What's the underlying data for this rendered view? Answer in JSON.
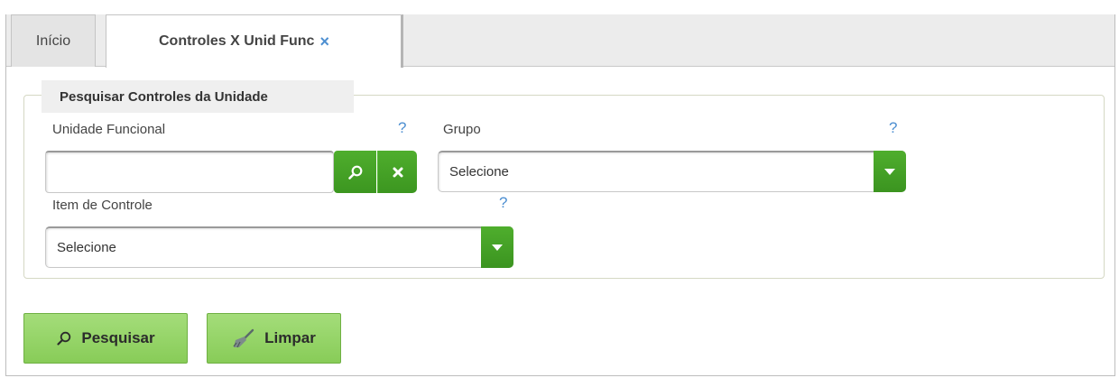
{
  "tabs": [
    {
      "label": "Início"
    },
    {
      "label": "Controles X Unid Func",
      "close": "×"
    }
  ],
  "panel": {
    "legend": "Pesquisar Controles da Unidade",
    "unidade": {
      "label": "Unidade Funcional",
      "value": "",
      "help": "?"
    },
    "grupo": {
      "label": "Grupo",
      "selected": "Selecione",
      "help": "?"
    },
    "item": {
      "label": "Item de Controle",
      "selected": "Selecione",
      "help": "?"
    }
  },
  "actions": {
    "search": "Pesquisar",
    "clear": "Limpar"
  },
  "colors": {
    "accent_green": "#3c9620",
    "button_green_light": "#a4dd7a",
    "help_blue": "#4d8fd1"
  }
}
